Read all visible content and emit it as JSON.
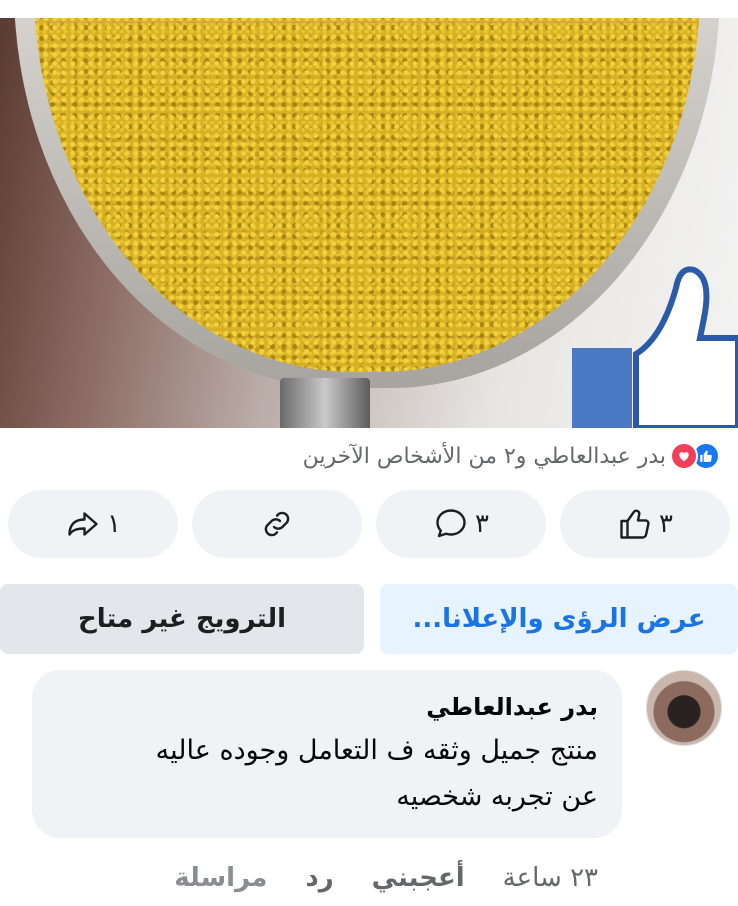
{
  "post": {
    "reactions_summary": "بدر عبدالعاطي و٢ من الأشخاص الآخرين",
    "reaction_icons": [
      "like-icon",
      "love-icon"
    ]
  },
  "actions": {
    "like_count": "٣",
    "comment_count": "٣",
    "share_count": "١"
  },
  "promotion": {
    "insights_label": "عرض الرؤى والإعلانا...",
    "unavailable_label": "الترويج غير متاح"
  },
  "comment": {
    "author": "بدر عبدالعاطي",
    "text": "منتج جميل وثقه ف التعامل  وجوده عاليه\nعن تجربه شخصيه",
    "time": "٢٣ ساعة",
    "like_label": "أعجبني",
    "reply_label": "رد",
    "message_label": "مراسلة"
  },
  "colors": {
    "accent": "#1877f2",
    "love": "#f33e58",
    "pill_bg": "#f0f2f5",
    "insights_bg": "#e7f3ff",
    "insights_text": "#1b74e4"
  }
}
